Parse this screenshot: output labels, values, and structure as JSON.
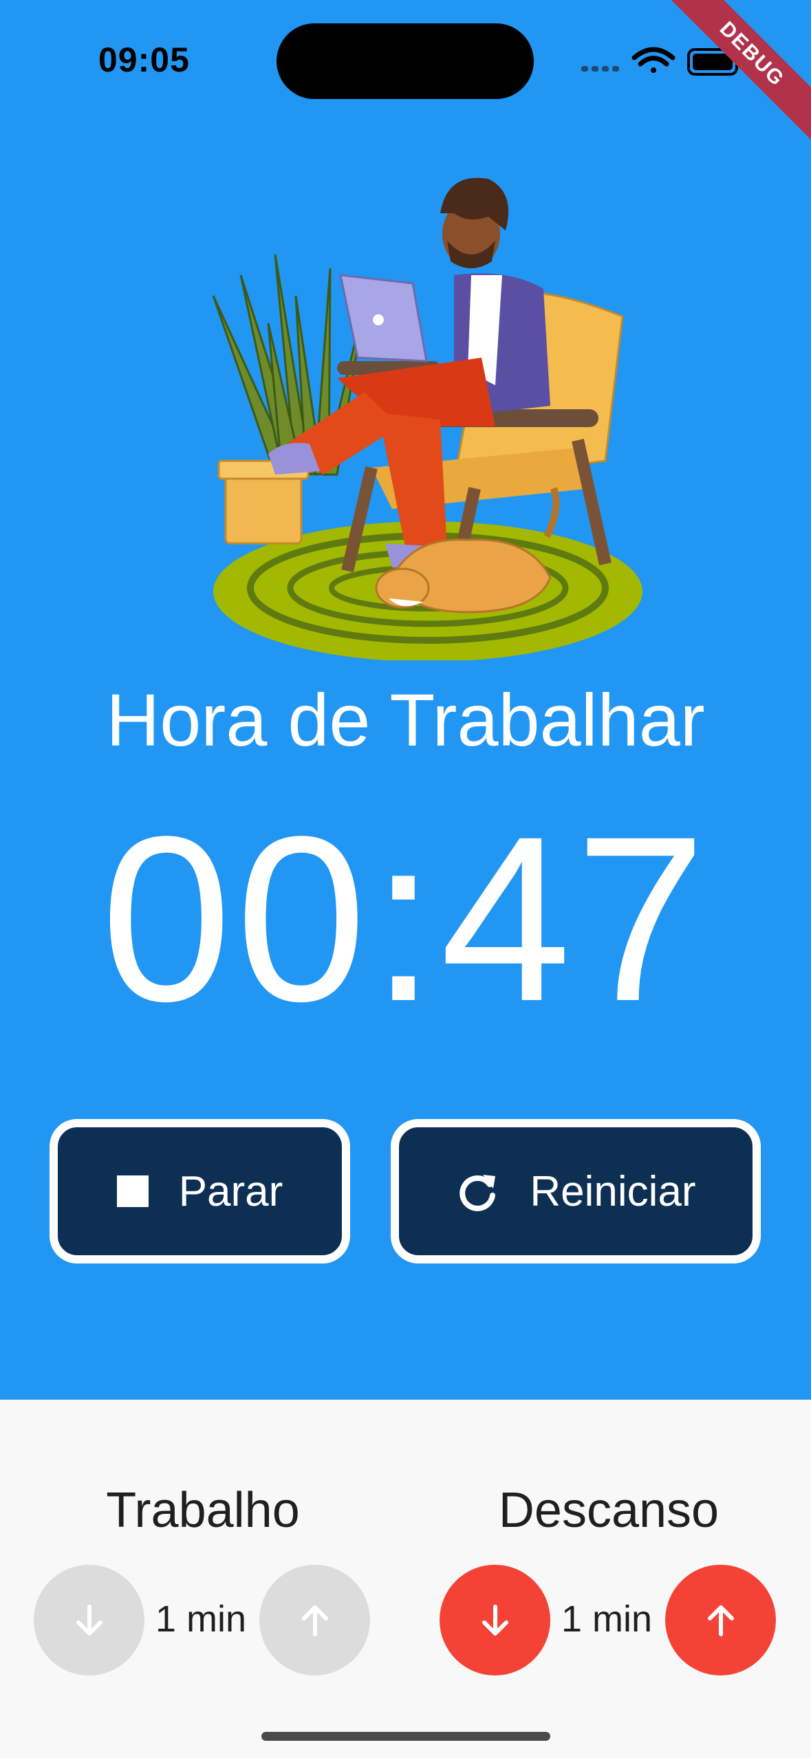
{
  "status_bar": {
    "time": "09:05",
    "debug_label": "DEBUG"
  },
  "mode": {
    "title": "Hora de Trabalhar"
  },
  "timer": {
    "display": "00:47"
  },
  "actions": {
    "stop_label": "Parar",
    "restart_label": "Reiniciar"
  },
  "settings": {
    "work": {
      "title": "Trabalho",
      "value": "1 min"
    },
    "rest": {
      "title": "Descanso",
      "value": "1 min"
    }
  },
  "colors": {
    "background": "#2196f3",
    "button": "#0d2f53",
    "accent": "#f44336",
    "disabled": "#dcdcdc"
  },
  "icons": [
    "stop-icon",
    "refresh-icon",
    "arrow-down-icon",
    "arrow-up-icon",
    "wifi-icon",
    "battery-icon",
    "signal-icon"
  ]
}
